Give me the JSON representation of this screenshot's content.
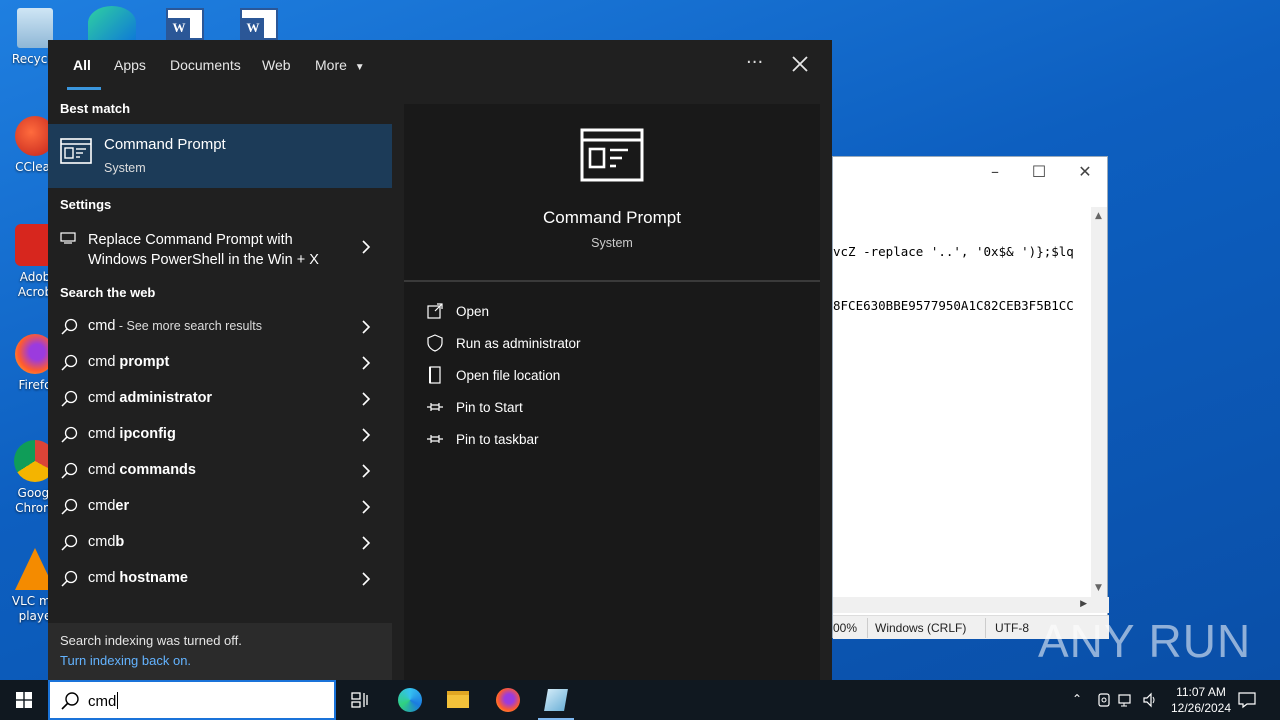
{
  "desktop": {
    "icons": [
      {
        "label": "Recycle",
        "icon": "recycle-bin-icon"
      },
      {
        "label": "CClear",
        "icon": "ccleaner-icon"
      },
      {
        "label": "Adob Acrob",
        "icon": "acrobat-icon"
      },
      {
        "label": "Firefo",
        "icon": "firefox-icon"
      },
      {
        "label": "Googl Chrom",
        "icon": "chrome-icon"
      },
      {
        "label": "VLC me playe",
        "icon": "vlc-icon"
      }
    ]
  },
  "notepad": {
    "text_lines": [
      "vcZ -replace '..', '0x$& ')};$lq",
      "8FCE630BBE9577950A1C82CEB3F5B1CC"
    ],
    "status": {
      "zoom": "00%",
      "line_ending": "Windows (CRLF)",
      "encoding": "UTF-8"
    }
  },
  "search": {
    "tabs": [
      "All",
      "Apps",
      "Documents",
      "Web",
      "More"
    ],
    "active_tab": "All",
    "best_match_heading": "Best match",
    "best_match": {
      "title": "Command Prompt",
      "subtitle": "System"
    },
    "settings_heading": "Settings",
    "settings_item": {
      "line1": "Replace Command Prompt with",
      "line2": "Windows PowerShell in the Win + X"
    },
    "web_heading": "Search the web",
    "web_results": [
      {
        "prefix": "cmd",
        "suffix": "",
        "note": " - See more search results"
      },
      {
        "prefix": "cmd ",
        "suffix": "prompt",
        "note": ""
      },
      {
        "prefix": "cmd ",
        "suffix": "administrator",
        "note": ""
      },
      {
        "prefix": "cmd ",
        "suffix": "ipconfig",
        "note": ""
      },
      {
        "prefix": "cmd ",
        "suffix": "commands",
        "note": ""
      },
      {
        "prefix": "cmd",
        "suffix": "er",
        "note": ""
      },
      {
        "prefix": "cmd",
        "suffix": "b",
        "note": ""
      },
      {
        "prefix": "cmd ",
        "suffix": "hostname",
        "note": ""
      }
    ],
    "index_note": {
      "text": "Search indexing was turned off.",
      "link": "Turn indexing back on."
    },
    "preview": {
      "title": "Command Prompt",
      "subtitle": "System",
      "actions": [
        {
          "label": "Open",
          "icon": "open-icon"
        },
        {
          "label": "Run as administrator",
          "icon": "shield-icon"
        },
        {
          "label": "Open file location",
          "icon": "file-location-icon"
        },
        {
          "label": "Pin to Start",
          "icon": "pin-icon"
        },
        {
          "label": "Pin to taskbar",
          "icon": "pin-icon"
        }
      ]
    }
  },
  "taskbar": {
    "search_value": "cmd",
    "apps": [
      "task-view-icon",
      "edge-icon",
      "file-explorer-icon",
      "firefox-icon",
      "notepad-icon"
    ],
    "clock": {
      "time": "11:07 AM",
      "date": "12/26/2024"
    }
  },
  "watermark": "ANY RUN"
}
